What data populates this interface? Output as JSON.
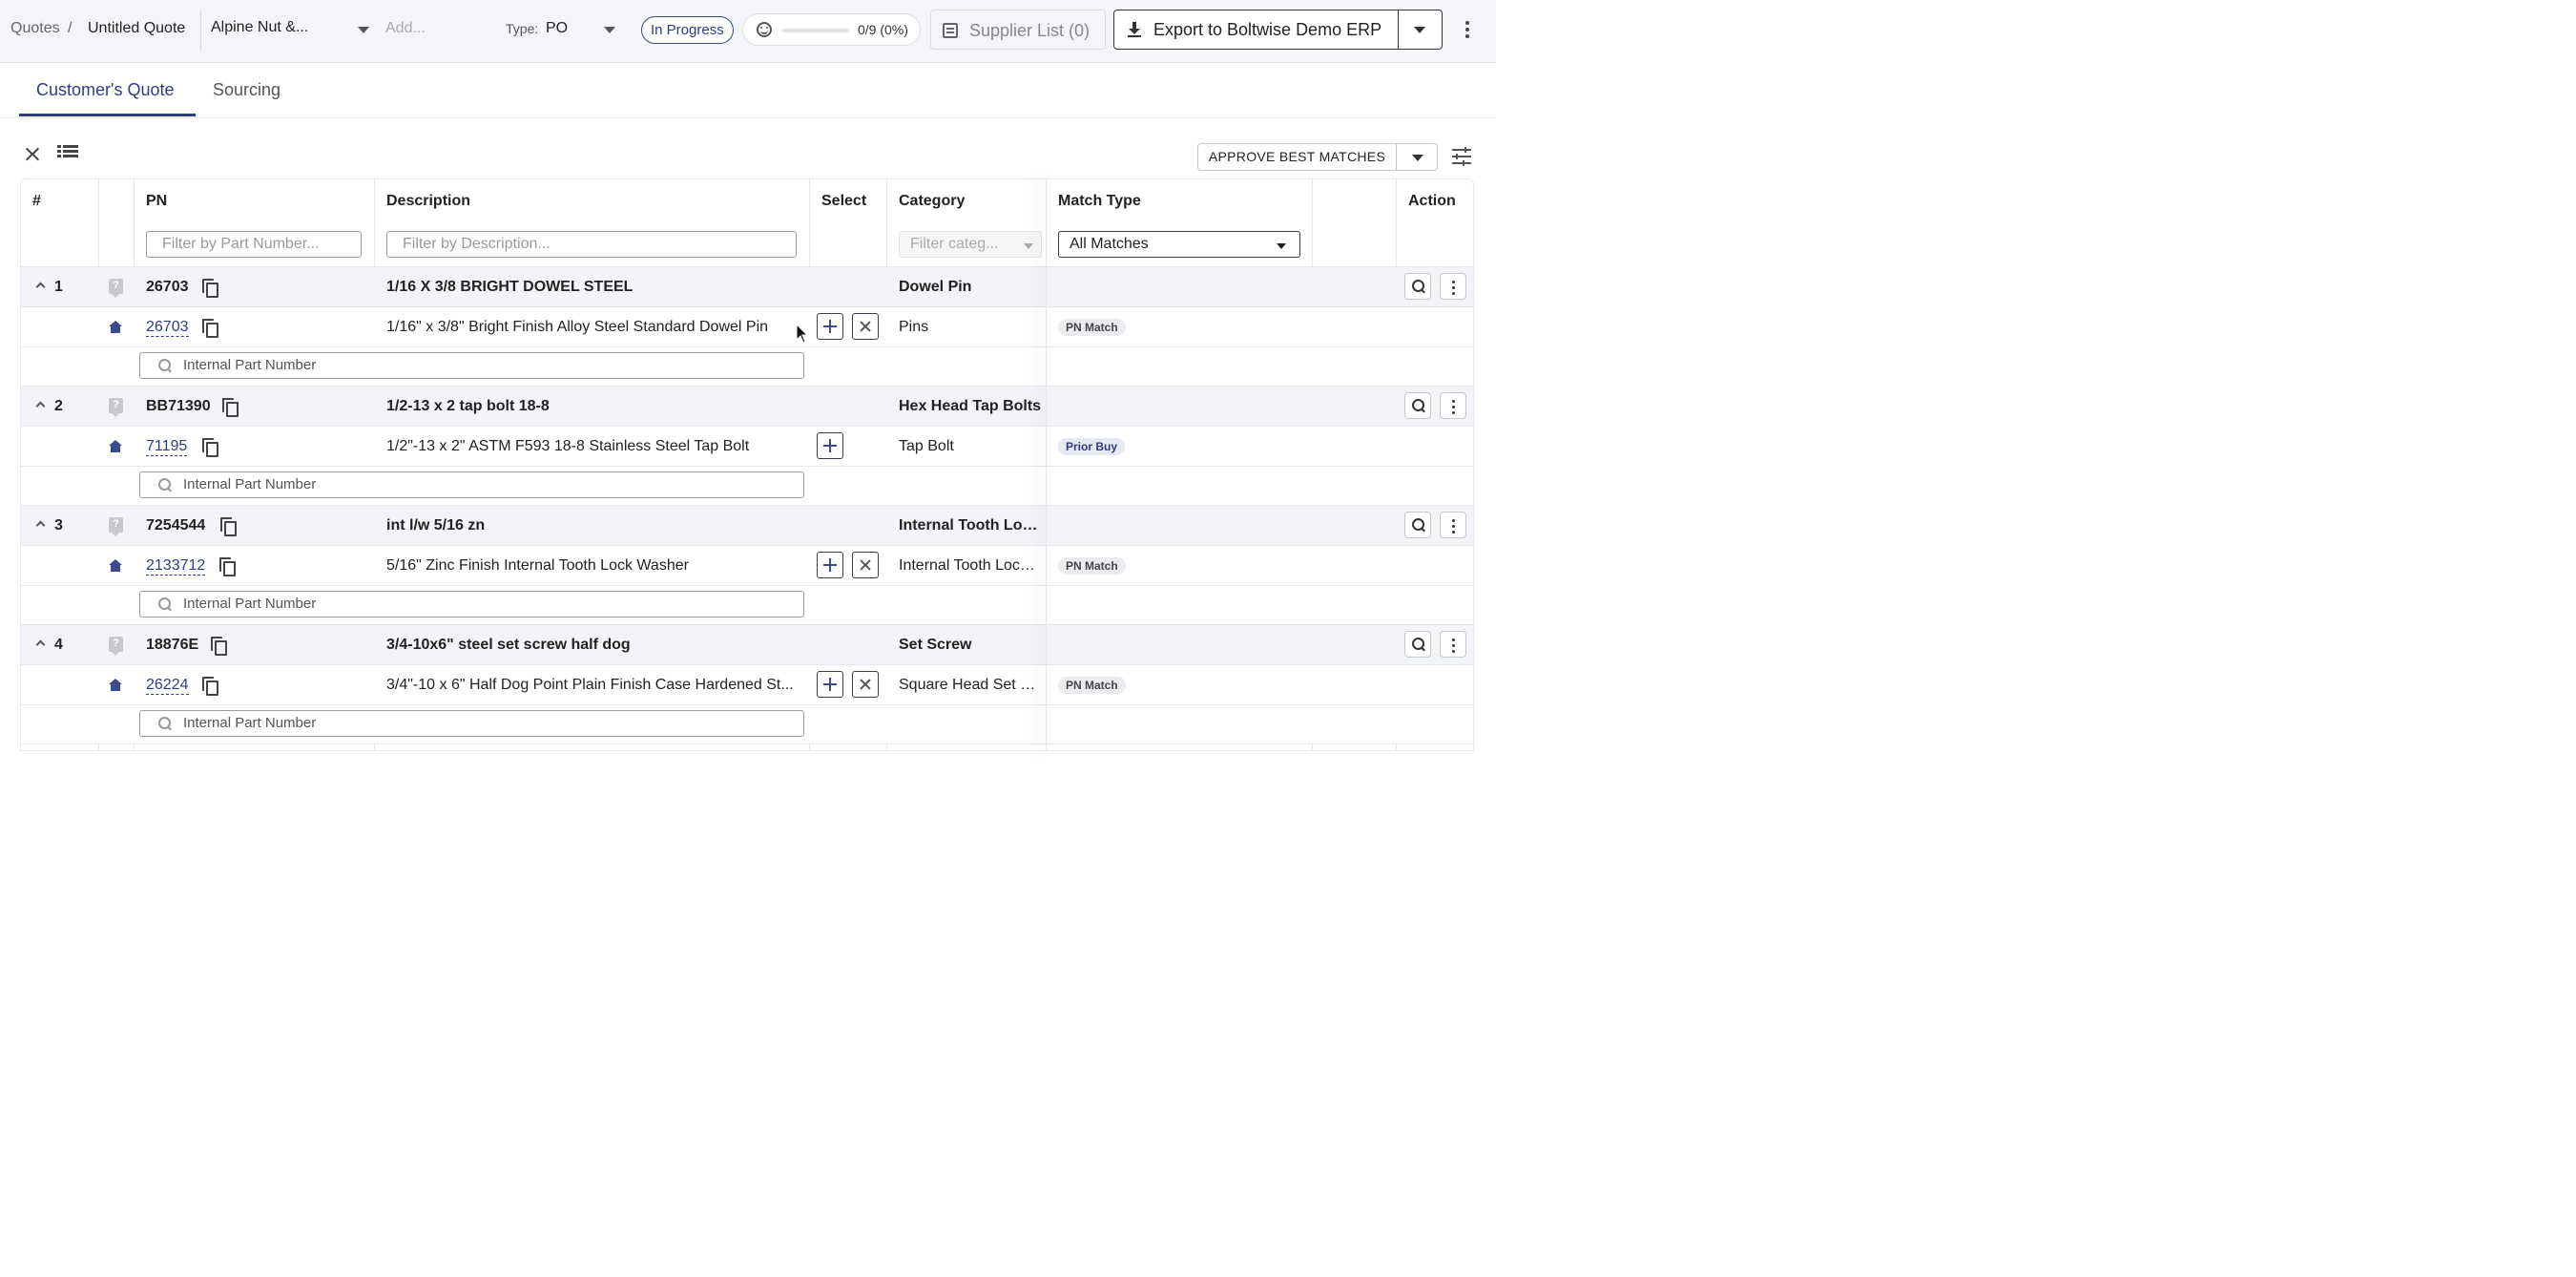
{
  "header": {
    "breadcrumb_root": "Quotes",
    "breadcrumb_sep": "/",
    "breadcrumb_current": "Untitled Quote",
    "customer": "Alpine Nut &...",
    "add_placeholder": "Add...",
    "type_label": "Type:",
    "type_value": "PO",
    "status": "In Progress",
    "progress_text": "0/9 (0%)",
    "progress_fraction": 0,
    "supplier_list": "Supplier List (0)",
    "export_label": "Export to Boltwise Demo ERP"
  },
  "tabs": [
    {
      "label": "Customer's Quote",
      "active": true
    },
    {
      "label": "Sourcing",
      "active": false
    }
  ],
  "toolbar": {
    "approve_label": "APPROVE BEST MATCHES"
  },
  "table": {
    "columns": {
      "num": "#",
      "pn": "PN",
      "description": "Description",
      "select": "Select",
      "category": "Category",
      "match_type": "Match Type",
      "action": "Action"
    },
    "filters": {
      "pn_placeholder": "Filter by Part Number...",
      "description_placeholder": "Filter by Description...",
      "category_placeholder": "Filter categ...",
      "match_type_value": "All Matches"
    },
    "search_placeholder": "Internal Part Number",
    "groups": [
      {
        "num": "1",
        "pn": "26703",
        "description": "1/16 X 3/8 BRIGHT DOWEL STEEL",
        "category": "Dowel Pin",
        "match": {
          "pn": "26703",
          "description": "1/16\" x 3/8\" Bright Finish Alloy Steel Standard Dowel Pin",
          "category": "Pins",
          "match_type": "PN Match"
        }
      },
      {
        "num": "2",
        "pn": "BB71390",
        "description": "1/2-13 x 2 tap bolt 18-8",
        "category": "Hex Head Tap Bolts",
        "match": {
          "pn": "71195",
          "description": "1/2\"-13 x 2\" ASTM F593 18-8 Stainless Steel Tap Bolt",
          "category": "Tap Bolt",
          "match_type": "Prior Buy"
        }
      },
      {
        "num": "3",
        "pn": "7254544",
        "description": "int l/w 5/16 zn",
        "category": "Internal Tooth Lock ...",
        "match": {
          "pn": "2133712",
          "description": "5/16\" Zinc Finish Internal Tooth Lock Washer",
          "category": "Internal Tooth Lock ...",
          "match_type": "PN Match"
        }
      },
      {
        "num": "4",
        "pn": "18876E",
        "description": "3/4-10x6\" steel set screw half dog",
        "category": "Set Screw",
        "match": {
          "pn": "26224",
          "description": "3/4\"-10 x 6\" Half Dog Point Plain Finish Case Hardened St...",
          "category": "Square Head Set Scr...",
          "match_type": "PN Match"
        }
      }
    ]
  }
}
